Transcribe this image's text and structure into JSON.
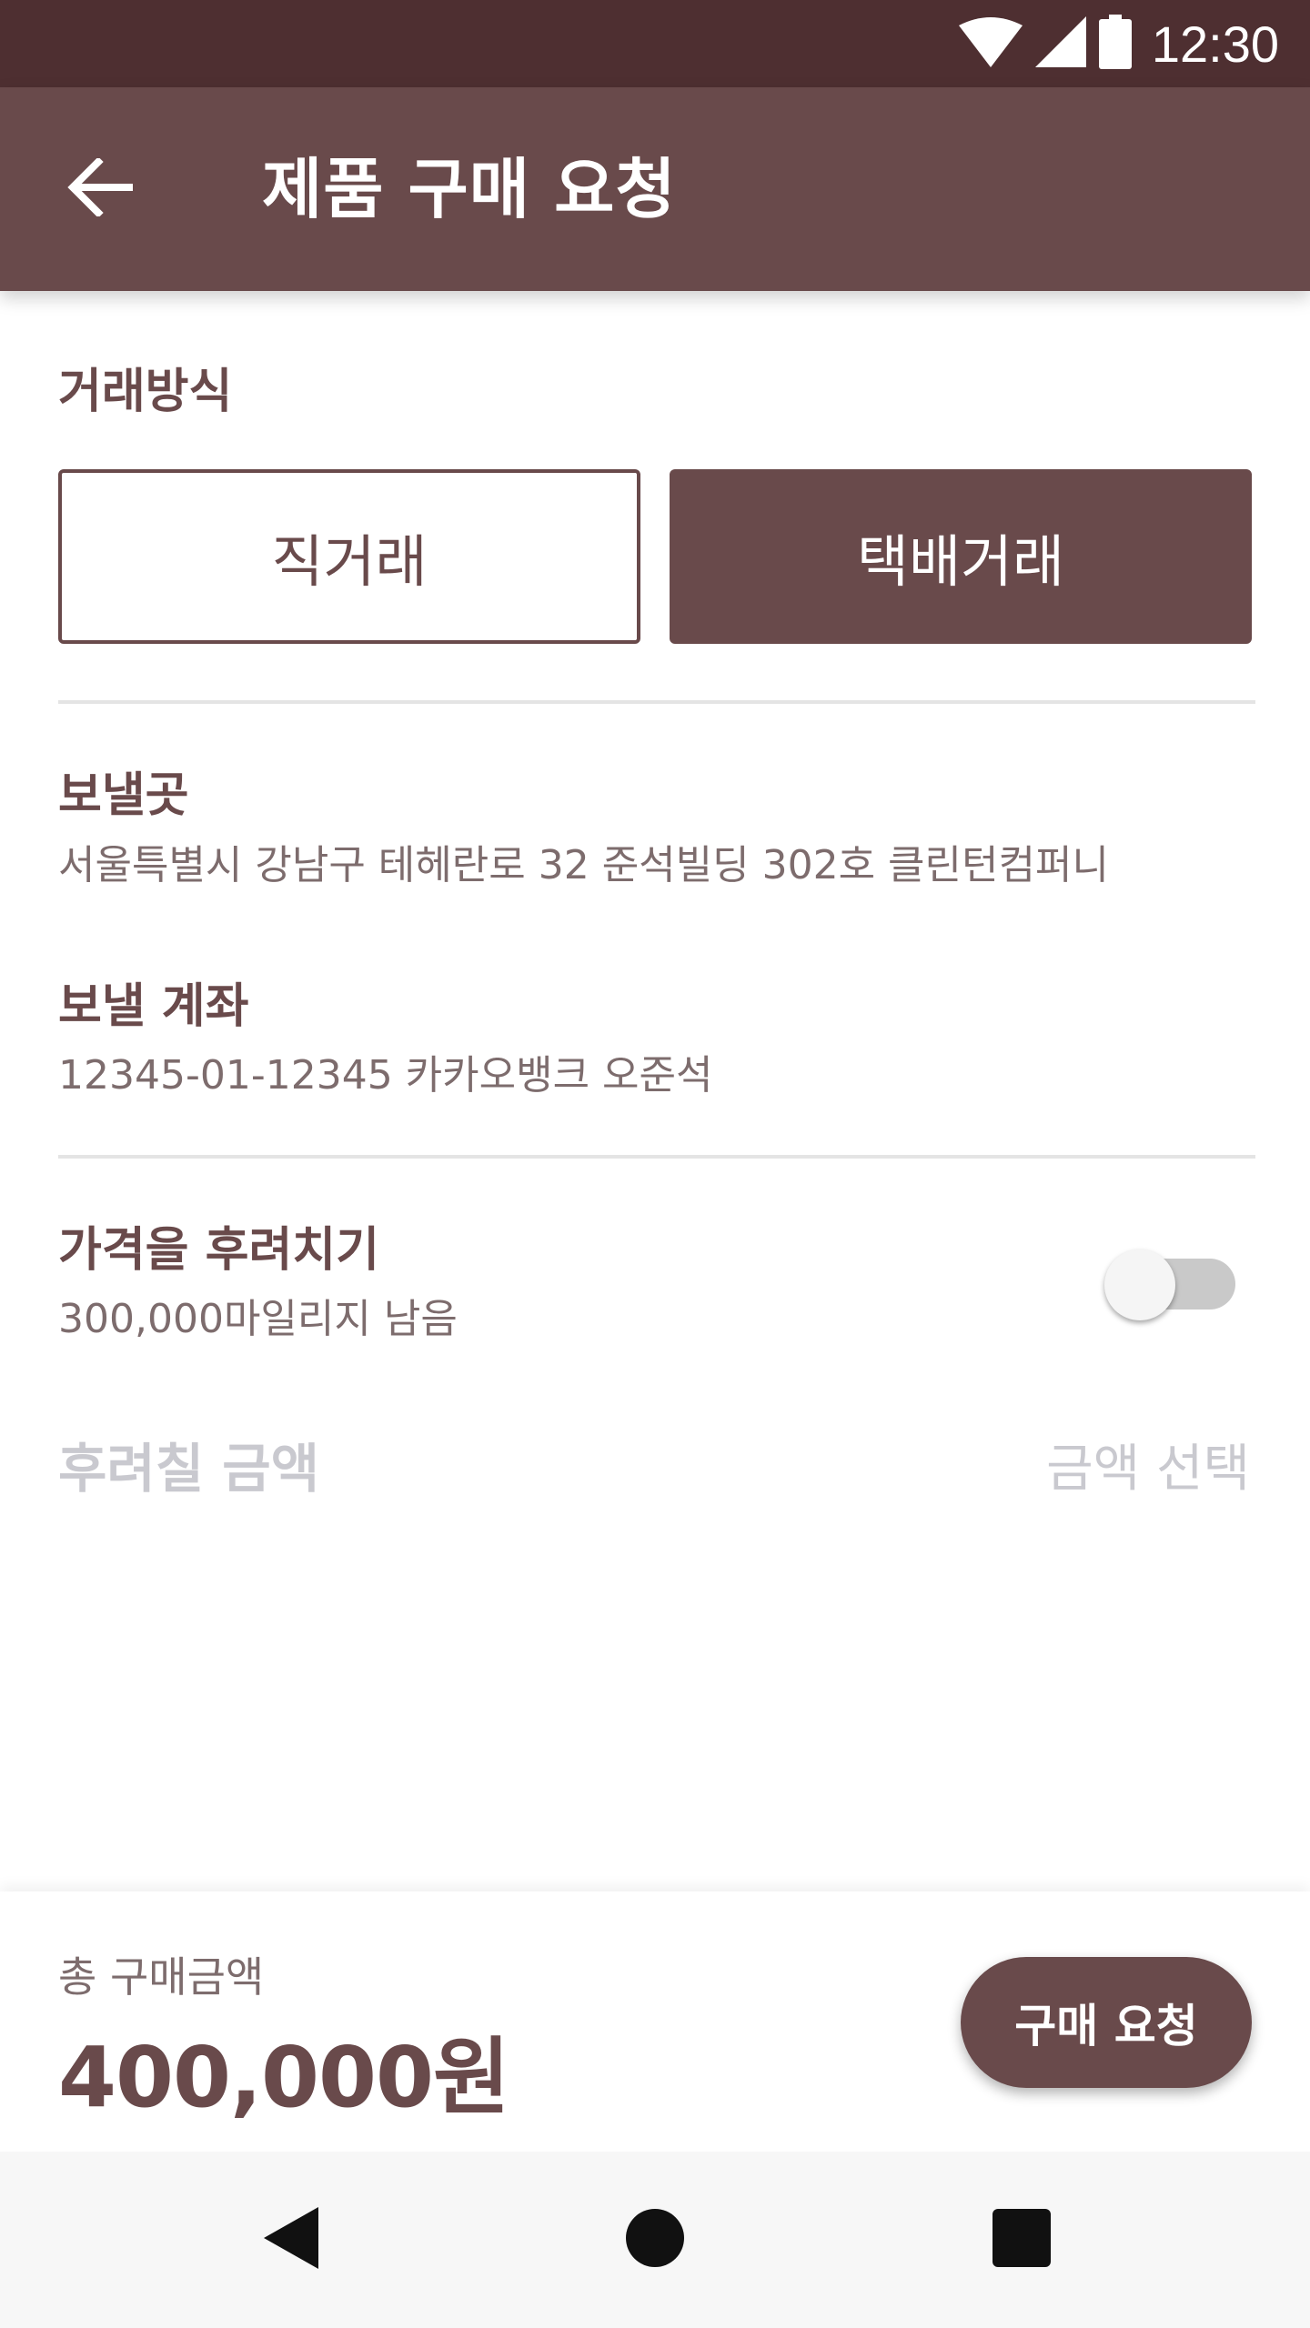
{
  "status_bar": {
    "time": "12:30",
    "icons": [
      "wifi-icon",
      "cellular-signal-icon",
      "battery-icon"
    ]
  },
  "app_bar": {
    "back_icon": "arrow-left-icon",
    "title": "제품 구매 요청"
  },
  "trade": {
    "section_label": "거래방식",
    "options": [
      {
        "label": "직거래",
        "selected": false
      },
      {
        "label": "택배거래",
        "selected": true
      }
    ]
  },
  "shipping": {
    "title": "보낼곳",
    "value": "서울특별시 강남구 테헤란로 32 준석빌딩 302호 클린턴컴퍼니"
  },
  "account": {
    "title": "보낼 계좌",
    "value": "12345-01-12345 카카오뱅크 오준석"
  },
  "discount": {
    "title": "가격을 후려치기",
    "subtitle": "300,000마일리지 남음",
    "toggle_on": false
  },
  "discount_amount": {
    "label": "후려칠 금액",
    "select_placeholder": "금액 선택"
  },
  "footer": {
    "total_label": "총 구매금액",
    "total_value": "400,000원",
    "purchase_button": "구매 요청"
  },
  "nav": {
    "icons": [
      "back-triangle-icon",
      "home-circle-icon",
      "recents-square-icon"
    ]
  },
  "colors": {
    "primary": "#694a4b",
    "status_bar": "#4e2f31",
    "disabled_text": "#c9c9cf",
    "secondary_text": "#7d6c6d"
  }
}
